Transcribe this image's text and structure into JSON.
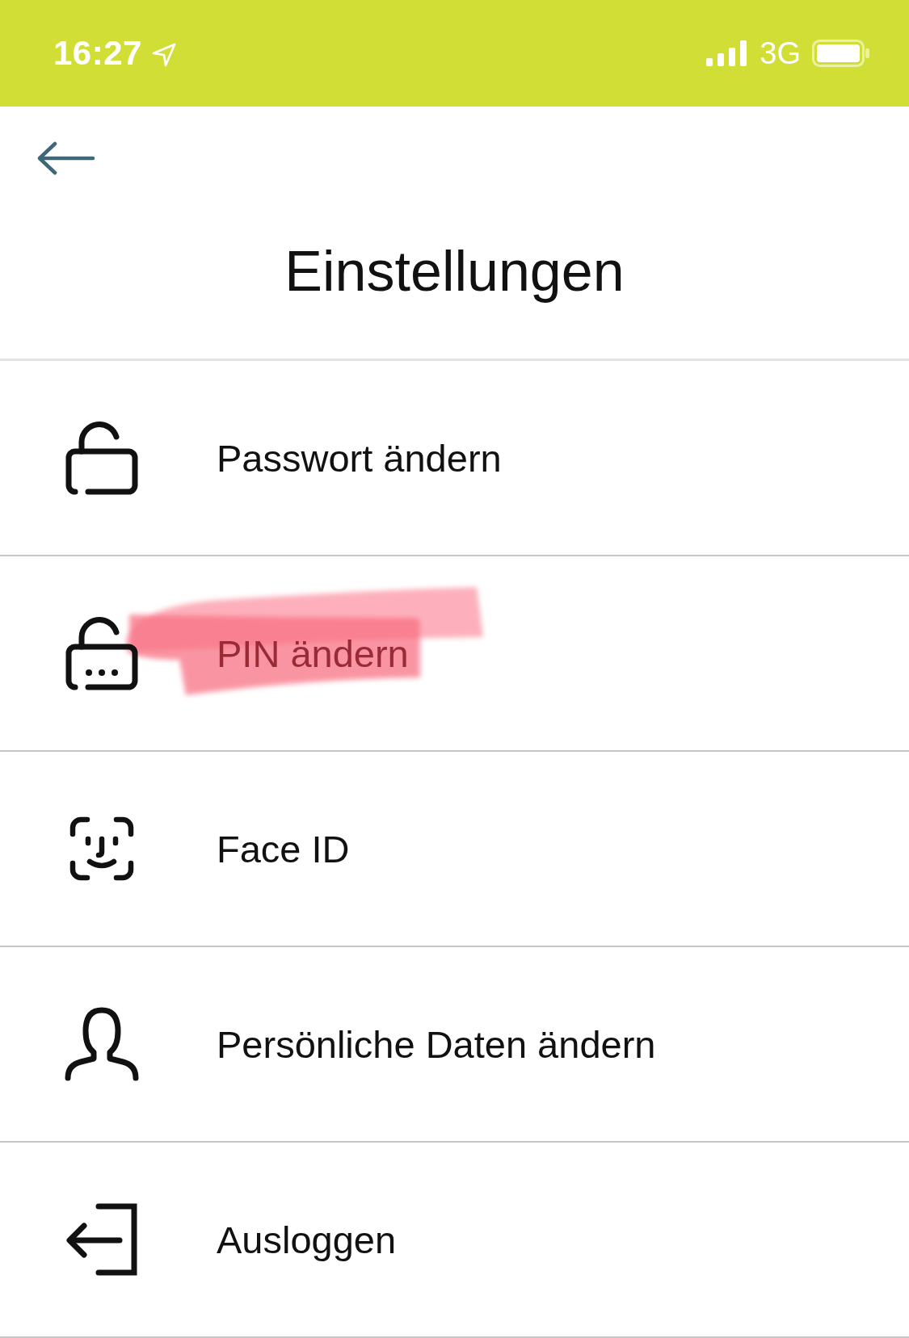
{
  "status_bar": {
    "time": "16:27",
    "network": "3G"
  },
  "header": {
    "title": "Einstellungen"
  },
  "items": [
    {
      "kind": "password",
      "label": "Passwort ändern",
      "highlighted": false
    },
    {
      "kind": "pin",
      "label": "PIN ändern",
      "highlighted": true
    },
    {
      "kind": "face",
      "label": "Face ID",
      "highlighted": false
    },
    {
      "kind": "person",
      "label": "Persönliche Daten ändern",
      "highlighted": false
    },
    {
      "kind": "logout",
      "label": "Ausloggen",
      "highlighted": false
    }
  ]
}
